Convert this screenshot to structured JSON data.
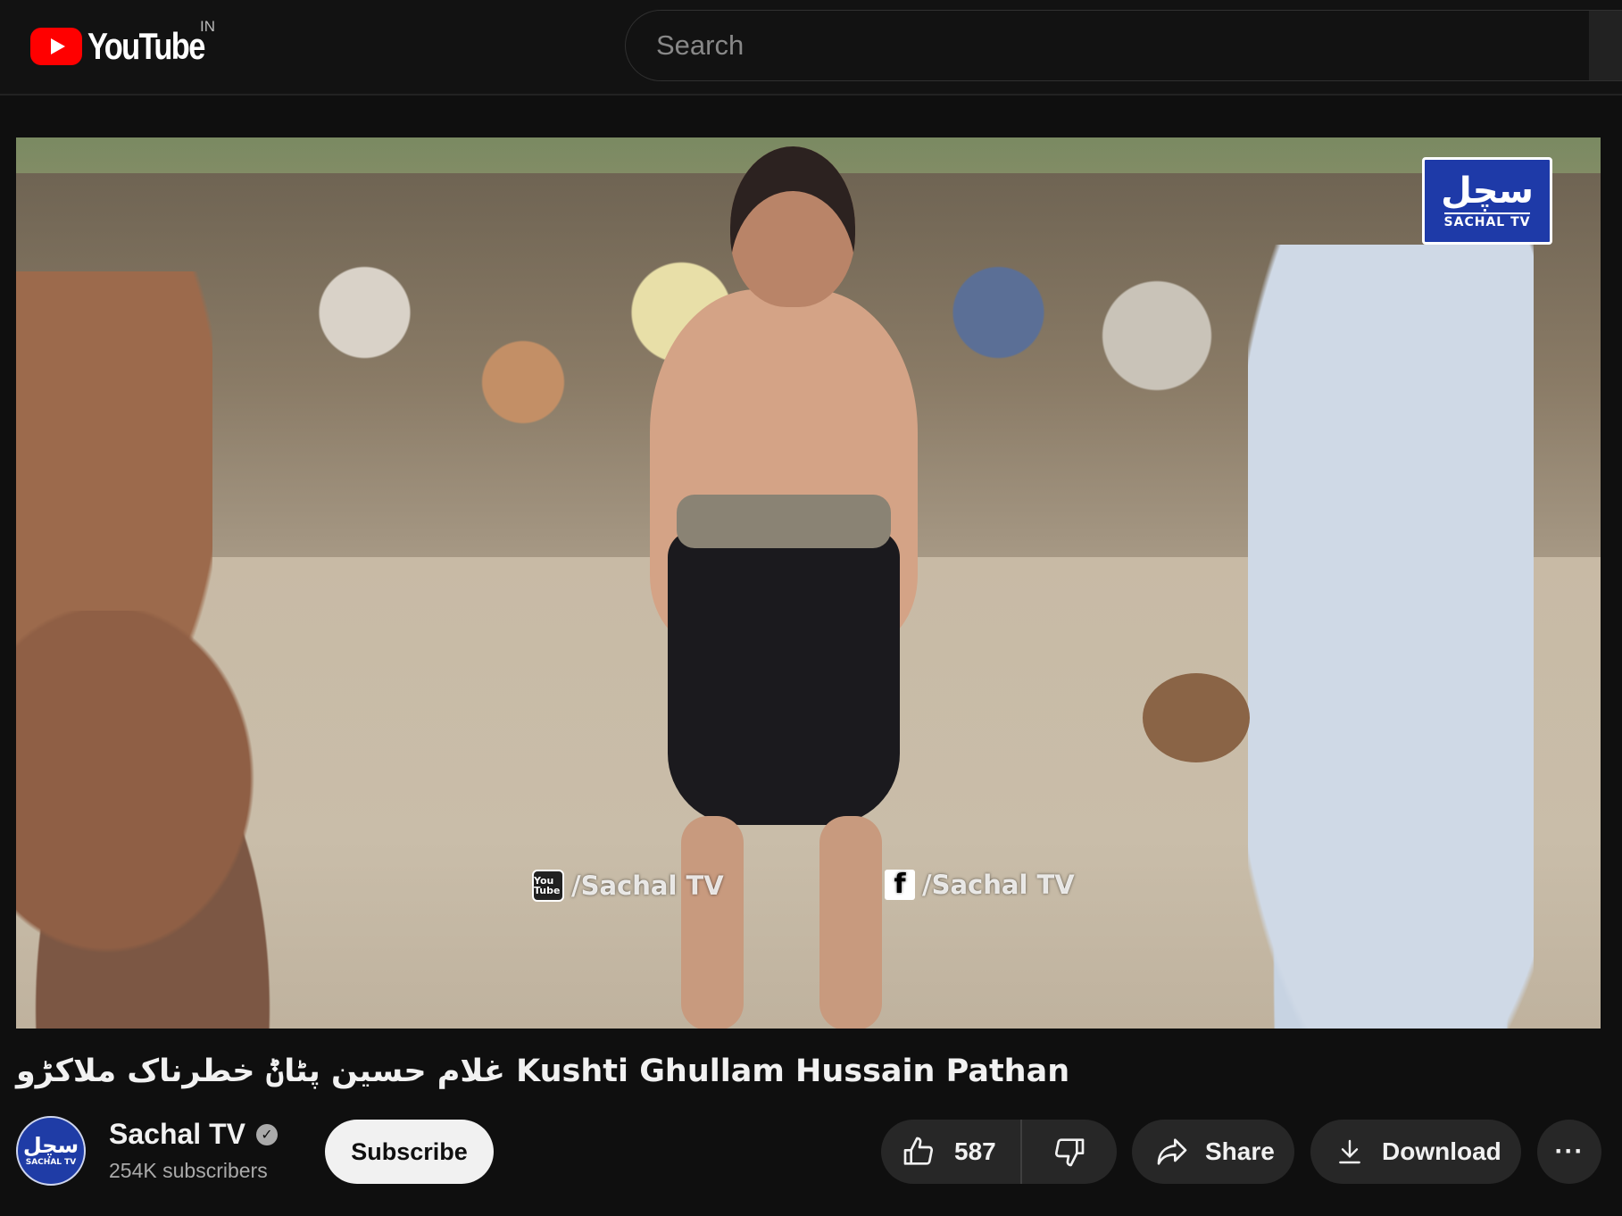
{
  "header": {
    "logo_text": "YouTube",
    "country_code": "IN",
    "search_placeholder": "Search"
  },
  "player": {
    "badge_urdu": "سچل",
    "badge_en": "SACHAL TV",
    "watermark_youtube": "/Sachal TV",
    "watermark_facebook": "/Sachal TV",
    "watermark_youtube_icon_text": "You Tube",
    "watermark_facebook_icon_text": "f"
  },
  "video": {
    "title": "غلام حسین پٹاݨ خطرناک ملاکڑو Kushti Ghullam Hussain Pathan"
  },
  "owner": {
    "avatar_urdu": "سچل",
    "avatar_en": "SACHAL TV",
    "channel_name": "Sachal TV",
    "verified_mark": "✓",
    "subscribers": "254K subscribers",
    "subscribe_label": "Subscribe"
  },
  "actions": {
    "like_count": "587",
    "share_label": "Share",
    "download_label": "Download",
    "more_label": "···"
  },
  "colors": {
    "background": "#0f0f0f",
    "brand_red": "#ff0000",
    "pill_bg": "#272727",
    "subscribe_bg": "#f1f1f1"
  },
  "icons": [
    "youtube-logo-icon",
    "search-icon",
    "thumbs-up-icon",
    "thumbs-down-icon",
    "share-arrow-icon",
    "download-icon",
    "more-dots-icon",
    "verified-check-icon"
  ]
}
